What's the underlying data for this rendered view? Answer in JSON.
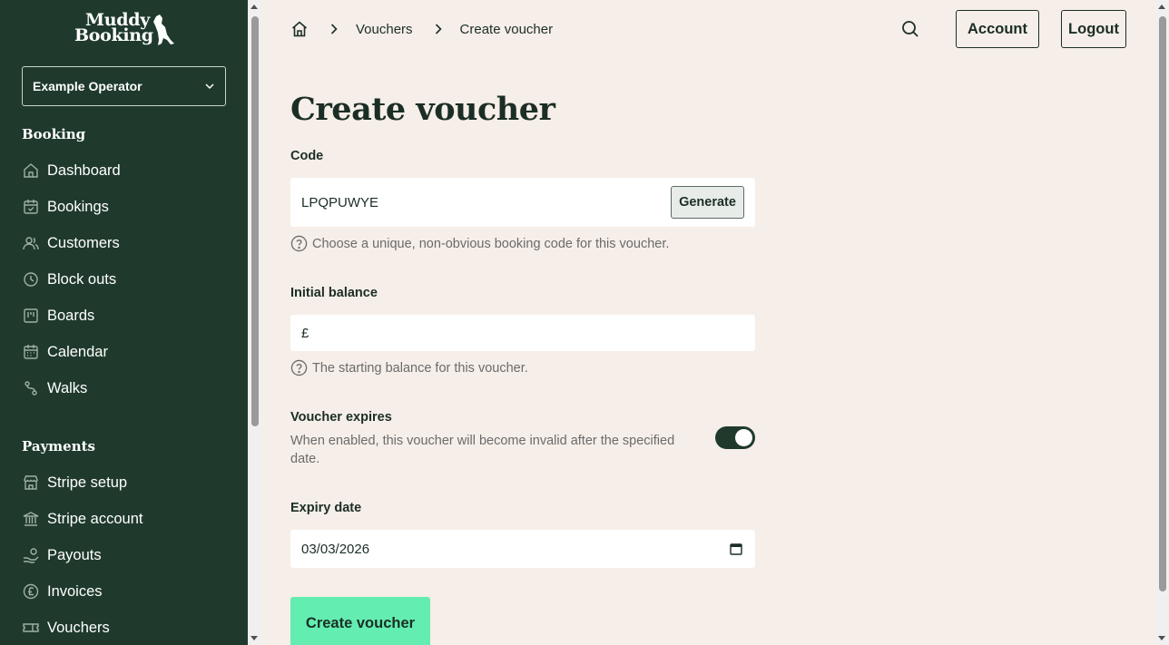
{
  "sidebar": {
    "logo": {
      "line1": "Muddy",
      "line2": "Booking"
    },
    "operator": "Example Operator",
    "sections": [
      {
        "title": "Booking",
        "items": [
          {
            "label": "Dashboard",
            "icon": "home-icon"
          },
          {
            "label": "Bookings",
            "icon": "calendar-check-icon"
          },
          {
            "label": "Customers",
            "icon": "users-icon"
          },
          {
            "label": "Block outs",
            "icon": "clock-icon"
          },
          {
            "label": "Boards",
            "icon": "board-icon"
          },
          {
            "label": "Calendar",
            "icon": "calendar-icon"
          },
          {
            "label": "Walks",
            "icon": "route-icon"
          }
        ]
      },
      {
        "title": "Payments",
        "items": [
          {
            "label": "Stripe setup",
            "icon": "store-icon"
          },
          {
            "label": "Stripe account",
            "icon": "bank-icon"
          },
          {
            "label": "Payouts",
            "icon": "hand-coins-icon"
          },
          {
            "label": "Invoices",
            "icon": "pound-icon"
          },
          {
            "label": "Vouchers",
            "icon": "ticket-icon"
          }
        ]
      }
    ]
  },
  "header": {
    "breadcrumbs": [
      "Vouchers",
      "Create voucher"
    ],
    "account_label": "Account",
    "logout_label": "Logout"
  },
  "page": {
    "title": "Create voucher",
    "code": {
      "label": "Code",
      "value": "LPQPUWYE",
      "generate_label": "Generate",
      "help": "Choose a unique, non-obvious booking code for this voucher."
    },
    "balance": {
      "label": "Initial balance",
      "prefix": "£",
      "value": "",
      "help": "The starting balance for this voucher."
    },
    "expires": {
      "label": "Voucher expires",
      "description": "When enabled, this voucher will become invalid after the specified date.",
      "enabled": true
    },
    "expiry_date": {
      "label": "Expiry date",
      "value": "03/03/2026"
    },
    "submit_label": "Create voucher"
  },
  "colors": {
    "sidebar_bg": "#1f3a2d",
    "page_bg": "#f6eee8",
    "accent": "#63edb1",
    "text_dark": "#1b2e25"
  }
}
